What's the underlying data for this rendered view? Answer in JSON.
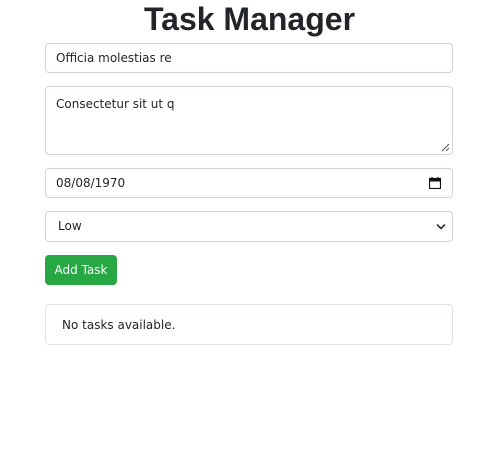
{
  "app": {
    "title": "Task Manager"
  },
  "form": {
    "title_value": "Officia molestias re",
    "description_value": "Consectetur sit ut q",
    "due_date_value": "08/08/1970",
    "priority": {
      "selected": "Low"
    },
    "add_button_label": "Add Task"
  },
  "task_list": {
    "empty_message": "No tasks available."
  },
  "colors": {
    "add_button": "#28a745",
    "input_border": "#ced4da",
    "text": "#212529"
  },
  "icons": {
    "date": "calendar-icon",
    "select": "chevron-down-icon",
    "textarea": "resize-grip-icon"
  }
}
